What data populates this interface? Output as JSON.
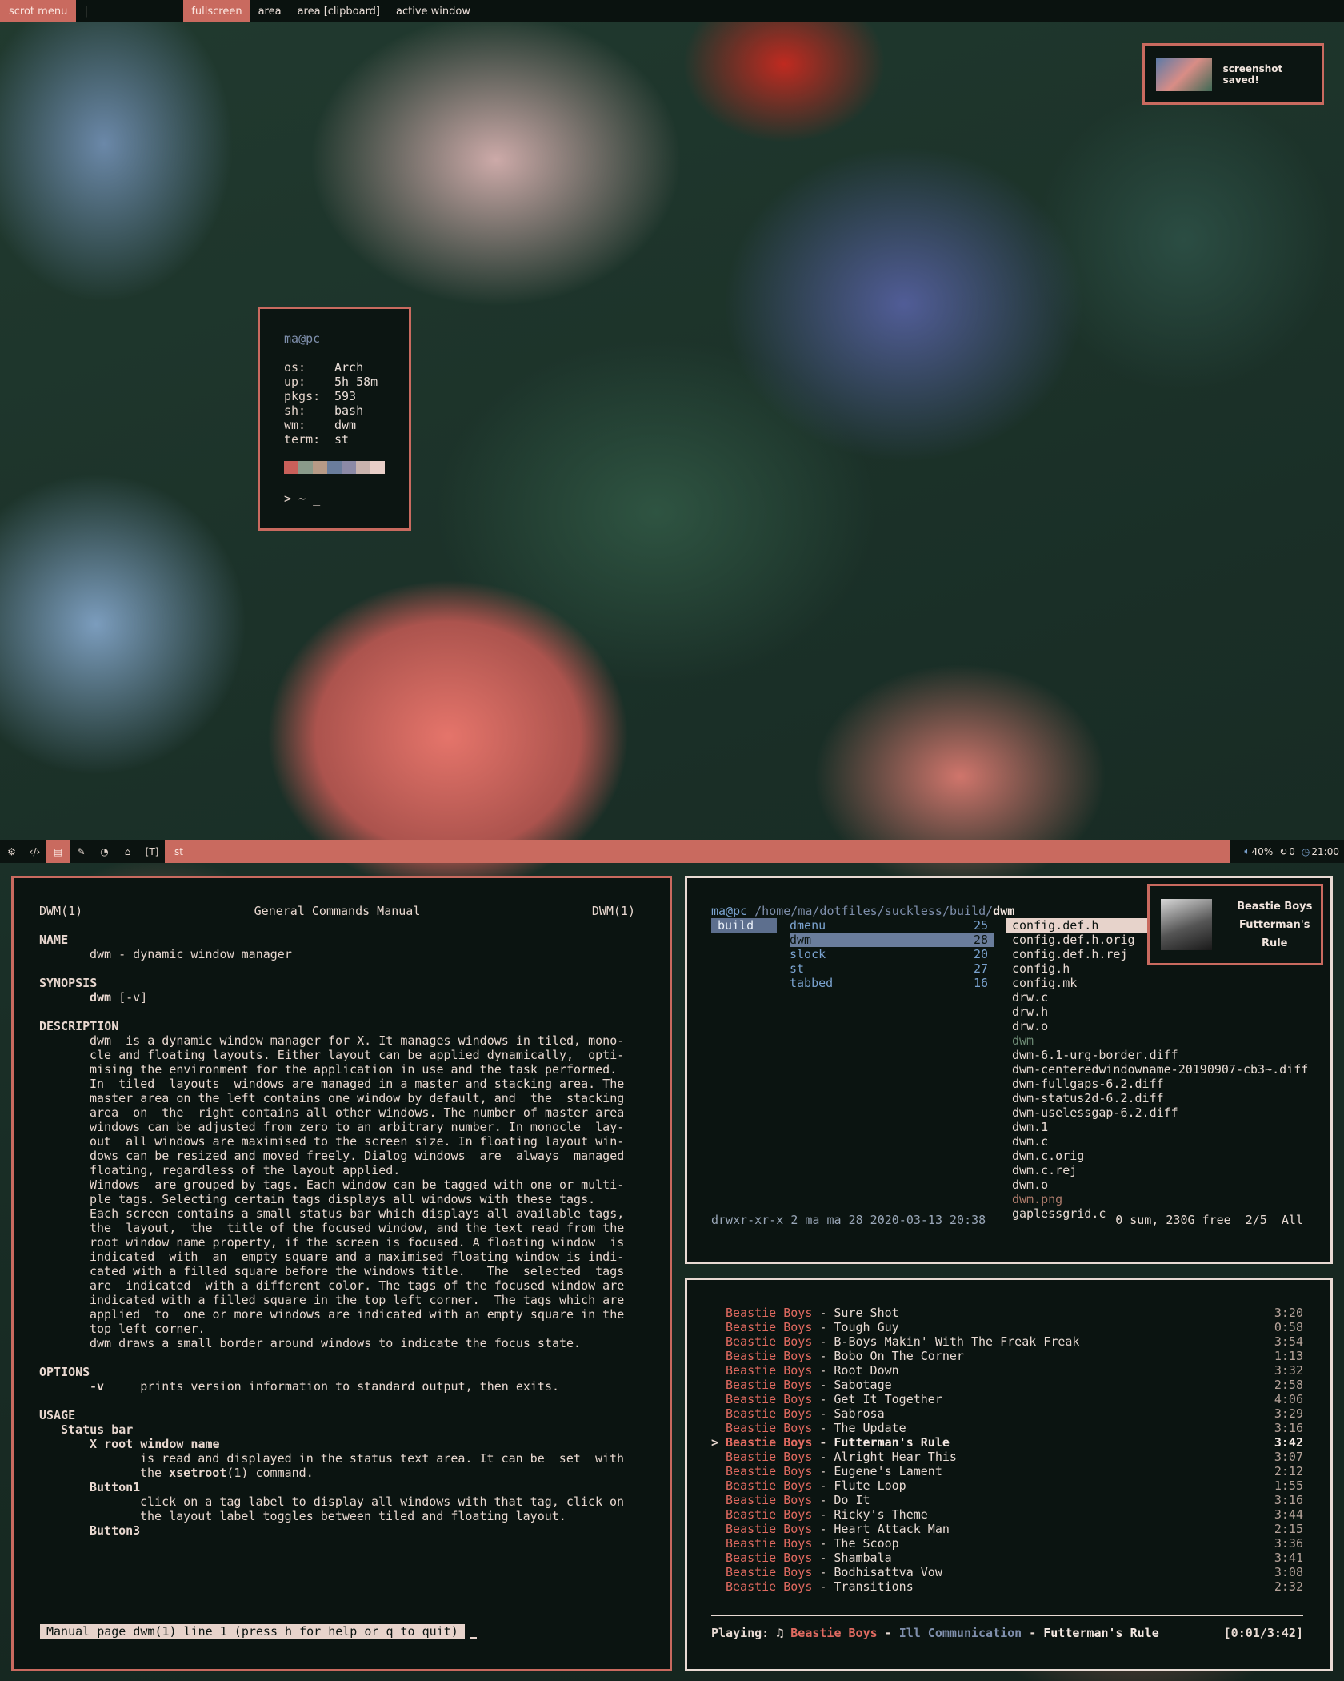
{
  "topbar": {
    "prompt": "scrot menu",
    "input": "",
    "items": [
      "fullscreen",
      "area",
      "area [clipboard]",
      "active window"
    ],
    "selected_index": 0
  },
  "notification_screenshot": {
    "text": "screenshot saved!"
  },
  "fetch": {
    "user": "ma",
    "host": "pc",
    "rows": [
      {
        "key": "os:",
        "value": "Arch"
      },
      {
        "key": "up:",
        "value": "5h 58m"
      },
      {
        "key": "pkgs:",
        "value": "593"
      },
      {
        "key": "sh:",
        "value": "bash"
      },
      {
        "key": "wm:",
        "value": "dwm"
      },
      {
        "key": "term:",
        "value": "st"
      }
    ],
    "swatches": [
      "#c9605a",
      "#8a9a8a",
      "#b79a86",
      "#6a7d9c",
      "#8c8aa6",
      "#c9b3ad",
      "#e9cfc8"
    ],
    "prompt": "> ~ _"
  },
  "dwmbar": {
    "tags": [
      "⚙",
      "‹/›",
      "▤",
      "✎",
      "◔",
      "⌂",
      "[T]"
    ],
    "selected_tag_index": 2,
    "layout": "[T]",
    "title": "st",
    "volume": "40%",
    "updates": "0",
    "clock": "21:00",
    "accent": "#c96a5f"
  },
  "man": {
    "header_left": "DWM(1)",
    "header_center": "General Commands Manual",
    "header_right": "DWM(1)",
    "name_title": "NAME",
    "name_text": "dwm - dynamic window manager",
    "synopsis_title": "SYNOPSIS",
    "synopsis_cmd": "dwm",
    "synopsis_args": " [-v]",
    "description_title": "DESCRIPTION",
    "description_paras": [
      "dwm  is a dynamic window manager for X. It manages windows in tiled, mono-\ncle and floating layouts. Either layout can be applied dynamically,  opti-\nmising the environment for the application in use and the task performed.",
      "In  tiled  layouts  windows are managed in a master and stacking area. The\nmaster area on the left contains one window by default, and  the  stacking\narea  on  the  right contains all other windows. The number of master area\nwindows can be adjusted from zero to an arbitrary number. In monocle  lay-\nout  all windows are maximised to the screen size. In floating layout win-\ndows can be resized and moved freely. Dialog windows  are  always  managed\nfloating, regardless of the layout applied.",
      "Windows  are grouped by tags. Each window can be tagged with one or multi-\nple tags. Selecting certain tags displays all windows with these tags.",
      "Each screen contains a small status bar which displays all available tags,\nthe  layout,  the  title of the focused window, and the text read from the\nroot window name property, if the screen is focused. A floating window  is\nindicated  with  an  empty square and a maximised floating window is indi-\ncated with a filled square before the windows title.   The  selected  tags\nare  indicated  with a different color. The tags of the focused window are\nindicated with a filled square in the top left corner.  The tags which are\napplied  to  one or more windows are indicated with an empty square in the\ntop left corner.",
      "dwm draws a small border around windows to indicate the focus state."
    ],
    "options_title": "OPTIONS",
    "option_flag": "-v",
    "option_text": "prints version information to standard output, then exits.",
    "usage_title": "USAGE",
    "statusbar_title": "Status bar",
    "xroot_title": "X root window name",
    "xroot_text1": "is read and displayed in the status text area. It can be  set  with",
    "xroot_text2_pre": "the ",
    "xroot_text2_cmd": "xsetroot",
    "xroot_text2_post": "(1) command.",
    "button1_title": "Button1",
    "button1_text": "click on a tag label to display all windows with that tag, click on\nthe layout label toggles between tiled and floating layout.",
    "button3_title": "Button3",
    "statusline": "Manual page dwm(1) line 1 (press h for help or q to quit)"
  },
  "ranger": {
    "user": "ma@pc",
    "path": "/home/ma/dotfiles/suckless/build/",
    "current": "dwm",
    "parent": [
      "build"
    ],
    "dirs": [
      {
        "name": "dmenu",
        "count": "25"
      },
      {
        "name": "dwm",
        "count": "28"
      },
      {
        "name": "slock",
        "count": "20"
      },
      {
        "name": "st",
        "count": "27"
      },
      {
        "name": "tabbed",
        "count": "16"
      }
    ],
    "selected_dir": 1,
    "files": [
      {
        "name": "config.def.h",
        "kind": "sel"
      },
      {
        "name": "config.def.h.orig",
        "kind": "file"
      },
      {
        "name": "config.def.h.rej",
        "kind": "file"
      },
      {
        "name": "config.h",
        "kind": "file"
      },
      {
        "name": "config.mk",
        "kind": "file"
      },
      {
        "name": "drw.c",
        "kind": "file"
      },
      {
        "name": "drw.h",
        "kind": "file"
      },
      {
        "name": "drw.o",
        "kind": "file"
      },
      {
        "name": "dwm",
        "kind": "dir"
      },
      {
        "name": "dwm-6.1-urg-border.diff",
        "kind": "file"
      },
      {
        "name": "dwm-centeredwindowname-20190907-cb3~.diff",
        "kind": "file"
      },
      {
        "name": "dwm-fullgaps-6.2.diff",
        "kind": "file"
      },
      {
        "name": "dwm-status2d-6.2.diff",
        "kind": "file"
      },
      {
        "name": "dwm-uselessgap-6.2.diff",
        "kind": "file"
      },
      {
        "name": "dwm.1",
        "kind": "file"
      },
      {
        "name": "dwm.c",
        "kind": "file"
      },
      {
        "name": "dwm.c.orig",
        "kind": "file"
      },
      {
        "name": "dwm.c.rej",
        "kind": "file"
      },
      {
        "name": "dwm.o",
        "kind": "file"
      },
      {
        "name": "dwm.png",
        "kind": "img"
      },
      {
        "name": "gaplessgrid.c",
        "kind": "file"
      }
    ],
    "footer_left": "drwxr-xr-x 2 ma ma 28 2020-03-13 20:38",
    "footer_right": "0 sum, 230G free  2/5  All"
  },
  "music_notification": {
    "artist": "Beastie Boys",
    "title": "Futterman's Rule"
  },
  "ncmpcpp": {
    "tracks": [
      {
        "artist": "Beastie Boys",
        "title": "Sure Shot",
        "length": "3:20"
      },
      {
        "artist": "Beastie Boys",
        "title": "Tough Guy",
        "length": "0:58"
      },
      {
        "artist": "Beastie Boys",
        "title": "B-Boys Makin' With The Freak Freak",
        "length": "3:54"
      },
      {
        "artist": "Beastie Boys",
        "title": "Bobo On The Corner",
        "length": "1:13"
      },
      {
        "artist": "Beastie Boys",
        "title": "Root Down",
        "length": "3:32"
      },
      {
        "artist": "Beastie Boys",
        "title": "Sabotage",
        "length": "2:58"
      },
      {
        "artist": "Beastie Boys",
        "title": "Get It Together",
        "length": "4:06"
      },
      {
        "artist": "Beastie Boys",
        "title": "Sabrosa",
        "length": "3:29"
      },
      {
        "artist": "Beastie Boys",
        "title": "The Update",
        "length": "3:16"
      },
      {
        "artist": "Beastie Boys",
        "title": "Futterman's Rule",
        "length": "3:42"
      },
      {
        "artist": "Beastie Boys",
        "title": "Alright Hear This",
        "length": "3:07"
      },
      {
        "artist": "Beastie Boys",
        "title": "Eugene's Lament",
        "length": "2:12"
      },
      {
        "artist": "Beastie Boys",
        "title": "Flute Loop",
        "length": "1:55"
      },
      {
        "artist": "Beastie Boys",
        "title": "Do It",
        "length": "3:16"
      },
      {
        "artist": "Beastie Boys",
        "title": "Ricky's Theme",
        "length": "3:44"
      },
      {
        "artist": "Beastie Boys",
        "title": "Heart Attack Man",
        "length": "2:15"
      },
      {
        "artist": "Beastie Boys",
        "title": "The Scoop",
        "length": "3:36"
      },
      {
        "artist": "Beastie Boys",
        "title": "Shambala",
        "length": "3:41"
      },
      {
        "artist": "Beastie Boys",
        "title": "Bodhisattva Vow",
        "length": "3:08"
      },
      {
        "artist": "Beastie Boys",
        "title": "Transitions",
        "length": "2:32"
      }
    ],
    "playing_index": 9,
    "playing_marker": ">",
    "progress": 0.0045,
    "playbar": {
      "label": "Playing:",
      "note": "♫",
      "artist": "Beastie Boys",
      "album": "Ill Communication",
      "title": "Futterman's Rule",
      "time": "[0:01/3:42]"
    }
  }
}
